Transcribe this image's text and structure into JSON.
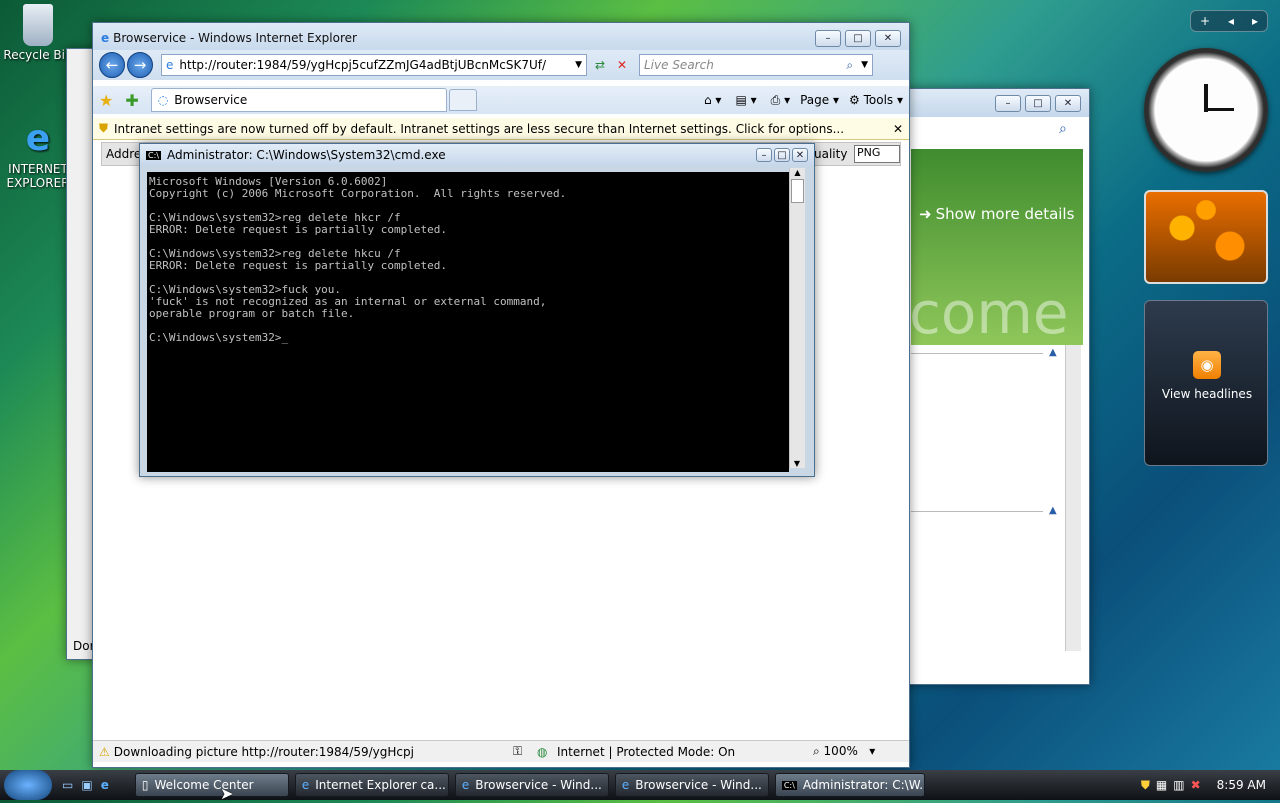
{
  "desktop": {
    "recycle_label": "Recycle Bin",
    "ie_label": "INTERNET EXPLORER"
  },
  "ie_main": {
    "title": "Browservice - Windows Internet Explorer",
    "url": "http://router:1984/59/ygHcpj5cufZZmJG4adBtjUBcnMcSK7Uf/",
    "search_placeholder": "Live Search",
    "tab_label": "Browservice",
    "menu_page": "Page",
    "menu_tools": "Tools",
    "infobar_text": "Intranet settings are now turned off by default. Intranet settings are less secure than Internet settings. Click for options...",
    "address_label": "Addre",
    "quality_label": "uality",
    "format_value": "PNG",
    "status_text": "Downloading picture http://router:1984/59/ygHcpj",
    "zone_text": "Internet | Protected Mode: On",
    "zoom_text": "100%"
  },
  "back_window": {
    "status_fragment": "Dor"
  },
  "welcome": {
    "show_details": "Show more details",
    "watermark": "come"
  },
  "cmd": {
    "title": "Administrator: C:\\Windows\\System32\\cmd.exe",
    "lines": "Microsoft Windows [Version 6.0.6002]\nCopyright (c) 2006 Microsoft Corporation.  All rights reserved.\n\nC:\\Windows\\system32>reg delete hkcr /f\nERROR: Delete request is partially completed.\n\nC:\\Windows\\system32>reg delete hkcu /f\nERROR: Delete request is partially completed.\n\nC:\\Windows\\system32>fuck you.\n'fuck' is not recognized as an internal or external command,\noperable program or batch file.\n\nC:\\Windows\\system32>_"
  },
  "sidebar": {
    "feed_label": "View headlines"
  },
  "taskbar": {
    "items": [
      {
        "label": "Welcome Center"
      },
      {
        "label": "Internet Explorer ca..."
      },
      {
        "label": "Browservice - Wind..."
      },
      {
        "label": "Browservice - Wind..."
      },
      {
        "label": "Administrator: C:\\W..."
      }
    ],
    "clock": "8:59 AM"
  }
}
